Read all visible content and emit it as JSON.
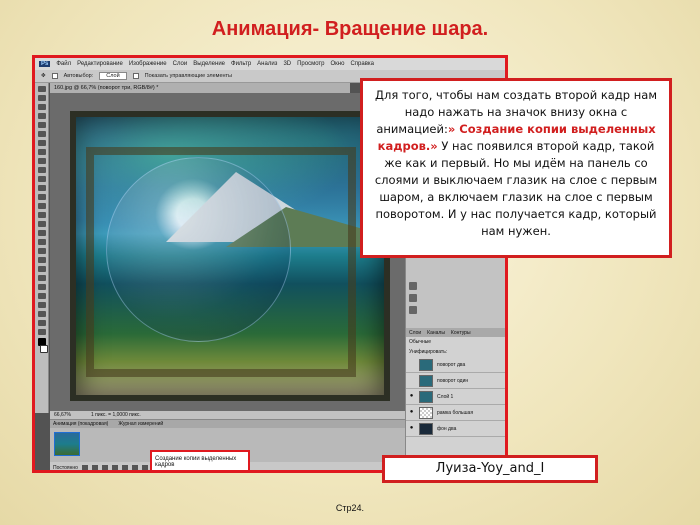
{
  "title": "Анимация- Вращение шара.",
  "ps": {
    "menu": [
      "Файл",
      "Редактирование",
      "Изображение",
      "Слои",
      "Выделение",
      "Фильтр",
      "Анализ",
      "3D",
      "Просмотр",
      "Окно",
      "Справка"
    ],
    "options": {
      "autoselect_label": "Автовыбор:",
      "autoselect_value": "Слой",
      "show_controls_label": "Показать управляющие элементы"
    },
    "doc_tab": "160.jpg @ 66,7% (поворот три, RGB/8#) *",
    "status": {
      "zoom": "66,67%",
      "doc_info": "1 пикс. = 1,0000 пикс."
    },
    "animation": {
      "tab1": "Анимация (покадровая)",
      "tab2": "Журнал измерений",
      "loop": "Постоянно"
    },
    "layers": {
      "tabs": [
        "Слои",
        "Каналы",
        "Контуры"
      ],
      "mode": "Обычные",
      "lock_label": "Унифицировать:",
      "items": [
        {
          "name": "поворот два",
          "selected": false
        },
        {
          "name": "поворот один",
          "selected": false
        },
        {
          "name": "Слой 1",
          "selected": false
        },
        {
          "name": "рамка большая",
          "selected": false
        },
        {
          "name": "фон два",
          "selected": false
        }
      ]
    },
    "tooltip": "Создание копии выделенных кадров"
  },
  "explain": {
    "text_before": "Для того, чтобы нам создать второй кадр нам надо нажать на значок внизу окна с анимацией:",
    "highlight": "» Создание копии выделенных кадров.»",
    "text_after": " У нас появился второй кадр, такой же как и первый. Но мы идём на панель со слоями и выключаем глазик на слое с первым шаром, а включаем глазик на слое с первым поворотом. И у нас получается кадр, который нам нужен."
  },
  "author": "Луиза-Yoy_and_I",
  "page": "Стр24."
}
